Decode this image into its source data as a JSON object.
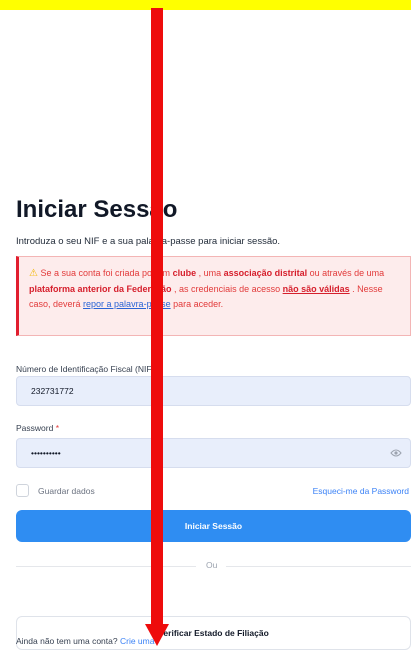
{
  "login": {
    "title": "Iniciar Sessão",
    "subtitle": "Introduza o seu NIF e a sua palavra-passe para iniciar sessão.",
    "alert": {
      "p1": "Se a sua conta foi criada por um ",
      "clube": "clube",
      "p2": " , uma ",
      "associacao": "associação distrital",
      "p3": " ou através de uma ",
      "plataforma": "plataforma anterior da Federação",
      "p4": " , as credenciais de acesso ",
      "nao_validas": "não são válidas",
      "p5": " . Nesse caso, deverá ",
      "repor": "repor a palavra-passe",
      "p6": " para aceder."
    },
    "nif_label": "Número de Identificação Fiscal (NIF)",
    "required_mark": "*",
    "nif_value": "232731772",
    "password_label": "Password",
    "password_value": "••••••••••",
    "remember_label": "Guardar dados",
    "forgot_label": "Esqueci-me da Password",
    "submit_label": "Iniciar Sessão",
    "or_label": "Ou",
    "verify_label": "Verificar Estado de Filiação",
    "signup_text": "Ainda não tem uma conta?",
    "signup_link": "Crie uma"
  },
  "colors": {
    "accent": "#2f8df2",
    "annotation": "#ee0c0c",
    "topbar": "#ffff00"
  },
  "icons": {
    "warning": "warning-icon",
    "eye": "eye-icon"
  }
}
